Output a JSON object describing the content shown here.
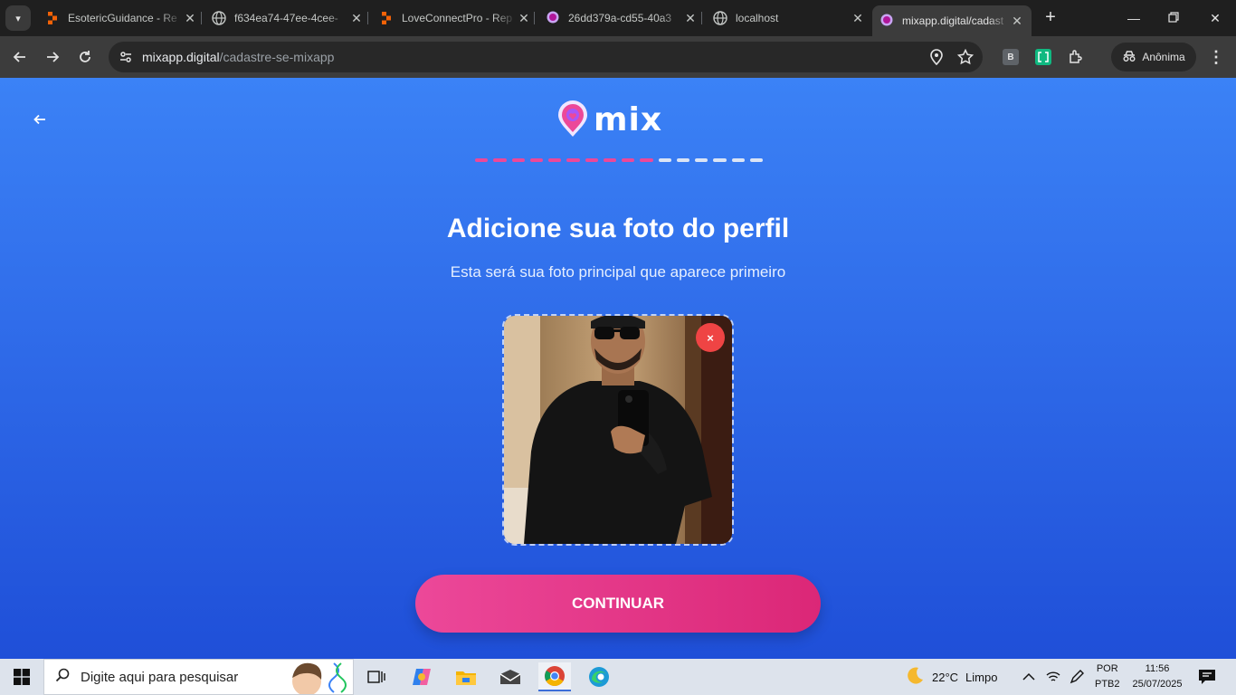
{
  "browser": {
    "tabs": [
      {
        "title": "EsotericGuidance - Re",
        "favicon": "replit-icon"
      },
      {
        "title": "f634ea74-47ee-4cee-",
        "favicon": "globe-icon"
      },
      {
        "title": "LoveConnectPro - Rep",
        "favicon": "replit-icon"
      },
      {
        "title": "26dd379a-cd55-40a3",
        "favicon": "mix-pin-icon"
      },
      {
        "title": "localhost",
        "favicon": "globe-icon"
      },
      {
        "title": "mixapp.digital/cadast",
        "favicon": "mix-pin-icon",
        "active": true
      }
    ],
    "url_host": "mixapp.digital",
    "url_path": "/cadastre-se-mixapp",
    "extensions": [
      "B"
    ],
    "incognito_label": "Anônima"
  },
  "page": {
    "logo_text": "mix",
    "progress": {
      "completed_steps": 10,
      "total_steps": 16,
      "completed_color": "#ec4899",
      "remaining_color": "#dbe4f5"
    },
    "heading": "Adicione sua foto do perfil",
    "subheading": "Esta será sua foto principal que aparece primeiro",
    "remove_photo_symbol": "×",
    "continue_label": "CONTINUAR",
    "colors": {
      "background_top": "#3b82f6",
      "background_bottom": "#1f4fd8",
      "accent": "#ec4899",
      "danger": "#ef4444"
    }
  },
  "taskbar": {
    "search_placeholder": "Digite aqui para pesquisar",
    "weather_temp": "22°C",
    "weather_desc": "Limpo",
    "lang_top": "POR",
    "lang_bottom": "PTB2",
    "time": "11:56",
    "date": "25/07/2025"
  }
}
